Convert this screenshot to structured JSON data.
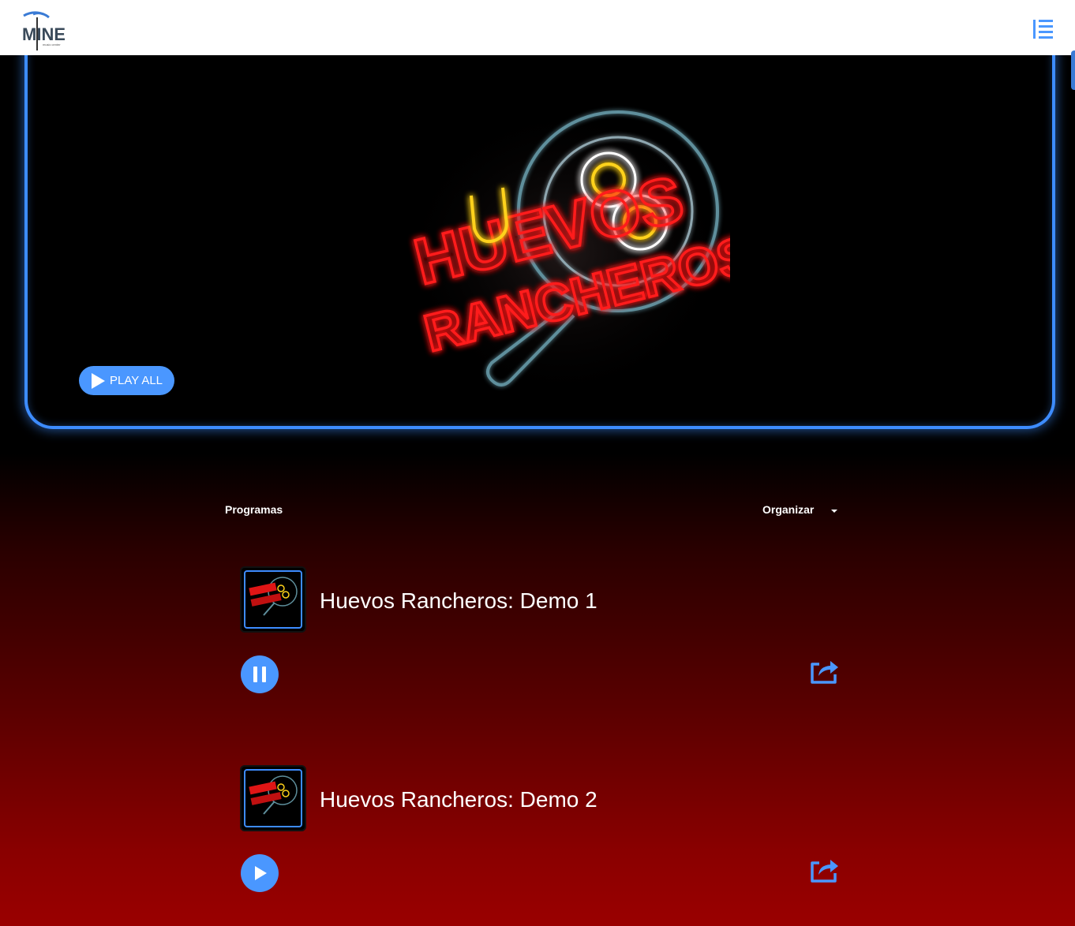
{
  "header": {
    "logo_text": "MINE",
    "logo_subtext": "music center"
  },
  "hero": {
    "artwork_lines": [
      "HUEVOS",
      "RANCHEROS"
    ],
    "play_all_label": "PLAY ALL"
  },
  "programs": {
    "label": "Programas",
    "sort_label": "Organizar"
  },
  "episodes": [
    {
      "title": "Huevos Rancheros: Demo 1",
      "state": "playing",
      "control_icon": "pause-icon"
    },
    {
      "title": "Huevos Rancheros: Demo 2",
      "state": "paused",
      "control_icon": "play-icon"
    }
  ],
  "colors": {
    "accent": "#4a97ff",
    "neon_border": "#3d8cff",
    "neon_red": "#ff1a1a",
    "neon_yellow": "#ffd21a",
    "pan_outline": "#5e8f9c",
    "background_bottom": "#9a0000"
  }
}
